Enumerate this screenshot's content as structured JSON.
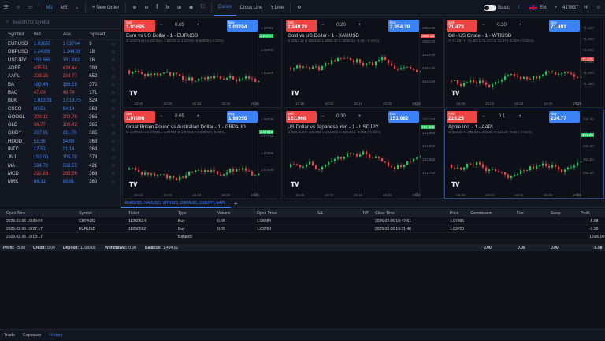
{
  "toolbar": {
    "tf1": "M1",
    "tf2": "M5",
    "new_order": "+ New Order",
    "fx": "fx",
    "cursor": "Cursor",
    "crosshair": "Cross Line",
    "yline": "Y Line",
    "toggle_label": "Basic",
    "lang": "EN",
    "account": "417837",
    "greeting": "Hi"
  },
  "watchlist": {
    "search_placeholder": "Search for symbol",
    "headers": [
      "Symbol",
      "Bid",
      "Ask",
      "Spread"
    ],
    "rows": [
      {
        "sym": "EURUSD",
        "bid": "1.03695",
        "ask": "1.03704",
        "sp": "9",
        "dir": "g"
      },
      {
        "sym": "GBPUSD",
        "bid": "1.24398",
        "ask": "1.24415",
        "sp": "18",
        "dir": "g"
      },
      {
        "sym": "USDJPY",
        "bid": "151.966",
        "ask": "151.982",
        "sp": "16",
        "dir": "g"
      },
      {
        "sym": "ADBE",
        "bid": "435.51",
        "ask": "439.44",
        "sp": "393",
        "dir": "r"
      },
      {
        "sym": "AAPL",
        "bid": "228.25",
        "ask": "234.77",
        "sp": "652",
        "dir": "r"
      },
      {
        "sym": "BA",
        "bid": "182.46",
        "ask": "186.18",
        "sp": "372",
        "dir": "g"
      },
      {
        "sym": "BAC",
        "bid": "47.03",
        "ask": "48.74",
        "sp": "171",
        "dir": "r"
      },
      {
        "sym": "BLK",
        "bid": "1,013.51",
        "ask": "1,018.75",
        "sp": "524",
        "dir": "g"
      },
      {
        "sym": "CSCO",
        "bid": "60.51",
        "ask": "64.14",
        "sp": "363",
        "dir": "g"
      },
      {
        "sym": "GOOGL",
        "bid": "200.11",
        "ask": "203.76",
        "sp": "365",
        "dir": "r"
      },
      {
        "sym": "GLD",
        "bid": "96.77",
        "ask": "100.42",
        "sp": "365",
        "dir": "r"
      },
      {
        "sym": "GDDY",
        "bid": "207.91",
        "ask": "211.76",
        "sp": "385",
        "dir": "g"
      },
      {
        "sym": "HOOD",
        "bid": "51.36",
        "ask": "54.99",
        "sp": "363",
        "dir": "g"
      },
      {
        "sym": "INTC",
        "bid": "17.51",
        "ask": "21.14",
        "sp": "363",
        "dir": "g"
      },
      {
        "sym": "JNJ",
        "bid": "152.00",
        "ask": "155.78",
        "sp": "378",
        "dir": "g"
      },
      {
        "sym": "MA",
        "bid": "564.72",
        "ask": "568.55",
        "sp": "421",
        "dir": "g"
      },
      {
        "sym": "MCD",
        "bid": "292.88",
        "ask": "295.56",
        "sp": "368",
        "dir": "r"
      },
      {
        "sym": "MRK",
        "bid": "86.31",
        "ask": "89.91",
        "sp": "360",
        "dir": "g"
      }
    ]
  },
  "charts": [
    {
      "title": "Euro vs US Dollar - 1 - EURUSD",
      "ohlc": "O 1.03714 H 1.03714 L 1.03702 C 1.03701 -0.00009 (-0.01%)",
      "sell": "1.03695",
      "buy": "1.03704",
      "spread": "0.05",
      "labels": "Sell|Buy",
      "y": [
        "1.03769",
        "1.03700",
        "1.03650"
      ],
      "last": "1.03707",
      "x": [
        "15:45",
        "16:00",
        "16:15",
        "16:30",
        "16:45"
      ],
      "tagcolor": "#22c55e"
    },
    {
      "title": "Gold vs US Dollar - 1 - XAUUSD",
      "ohlc": "O 2853.11 H 2853.43 L 2850.17 C 2850.22 -0.28 (-0.01%)",
      "sell": "2,849.29",
      "buy": "2,854.39",
      "spread": "0.20",
      "labels": "Sell|Buy",
      "y": [
        "2852.00",
        "2850.00",
        "2848.00",
        "2846.00",
        "2844.00"
      ],
      "last": "2850.41",
      "x": [
        "15:45",
        "16:00",
        "16:15",
        "16:30",
        "16:45"
      ],
      "tagcolor": "#ef4444"
    },
    {
      "title": "Oil - US Crude - 1 - WTIUSD",
      "ohlc": "O 71.482 H 71.482 L 71.473 C 71.473 -0.009 (-0.01%)",
      "sell": "71.473",
      "buy": "71.493",
      "spread": "0.30",
      "labels": "Sell|Buy",
      "y": [
        "71.600",
        "71.550",
        "71.500",
        "71.450",
        "71.400",
        "71.350"
      ],
      "last": "71.475",
      "x": [
        "15:45",
        "16:00",
        "16:15",
        "16:30",
        "16:45"
      ],
      "tagcolor": "#ef4444"
    },
    {
      "title": "Great Britain Pound vs Australian Dollar - 1 - GBPAUD",
      "ohlc": "O 1.97941 H 1.97946 L 1.97940 C 1.97941 +0.00001 (+0.00%)",
      "sell": "1.97896",
      "buy": "1.98055",
      "spread": "0.05",
      "labels": "Sell|Buy",
      "y": [
        "1.98000",
        "1.97943",
        "1.97800",
        "1.97600"
      ],
      "last": "1.97943",
      "x": [
        "15:45",
        "16:00",
        "16:15",
        "16:30",
        "16:45"
      ],
      "tagcolor": "#22c55e"
    },
    {
      "title": "US Dollar vs Japanese Yen - 1 - USDJPY",
      "ohlc": "O 151.968 H 151.968 L 151.966 C 151.966 -0.002 (-0.00%)",
      "sell": "151.966",
      "buy": "151.982",
      "spread": "0.30",
      "labels": "Sell|Buy",
      "y": [
        "152.100",
        "151.966",
        "151.900",
        "151.800",
        "151.700"
      ],
      "last": "151.966",
      "x": [
        "15:45",
        "16:00",
        "16:15",
        "16:30",
        "16:45"
      ],
      "tagcolor": "#22c55e"
    },
    {
      "title": "Apple Inc. - 1 - AAPL",
      "ohlc": "O 231.22 H 231.23 L 231.20 C 231.20 -0.03 (-0.01%)",
      "sell": "228.25",
      "buy": "234.77",
      "spread": "0.1",
      "labels": "Sell|Buy",
      "y": [
        "232.00",
        "231.50",
        "231.20",
        "231.00",
        "230.50"
      ],
      "last": "231.20",
      "x": [
        "15:45",
        "16:00",
        "16:15",
        "16:30",
        "16:45"
      ],
      "tagcolor": "#22c55e"
    }
  ],
  "tabs": {
    "symbols": "EURUSD, XAUUSD, WTIUSD, GBPAUD, USDJPY, AAPL",
    "add": "+"
  },
  "history": {
    "headers": [
      "Open Time",
      "Symbol",
      "Ticket",
      "Type",
      "Volume",
      "Open Price",
      "S/L",
      "T/P",
      "Close Time",
      "Price",
      "Commission",
      "Fee",
      "Swap",
      "Profit"
    ],
    "rows": [
      [
        "2025.02.06 19:30:04",
        "GBPAUD",
        "18250514",
        "Buy",
        "0.05",
        "1.98084",
        "",
        "",
        "2025.02.06 19:47:51",
        "1.97895",
        "",
        "",
        "",
        "-5.68"
      ],
      [
        "2025.02.06 19:27:17",
        "EURUSD",
        "18250502",
        "Buy",
        "0.05",
        "1.03760",
        "",
        "",
        "2025.02.06 19:31:48",
        "1.03700",
        "",
        "",
        "",
        "-3.30"
      ],
      [
        "2025.02.06 19:18:17",
        "",
        "",
        "Balance",
        "",
        "",
        "",
        "",
        "",
        "",
        "",
        "",
        "",
        "1,500.00"
      ]
    ],
    "summary": {
      "profit_label": "Profit:",
      "profit": "-5.98",
      "credit_label": "Credit:",
      "credit": "0.00",
      "deposit_label": "Deposit:",
      "deposit": "1,500.00",
      "withdrawal_label": "Withdrawal:",
      "withdrawal": "0.00",
      "balance_label": "Balance:",
      "balance": "1,494.02",
      "commission": "0.00",
      "fee": "0.00",
      "swap": "0.00",
      "total": "-5.98"
    }
  },
  "bottom_tabs": [
    "Trade",
    "Exposure",
    "History"
  ]
}
